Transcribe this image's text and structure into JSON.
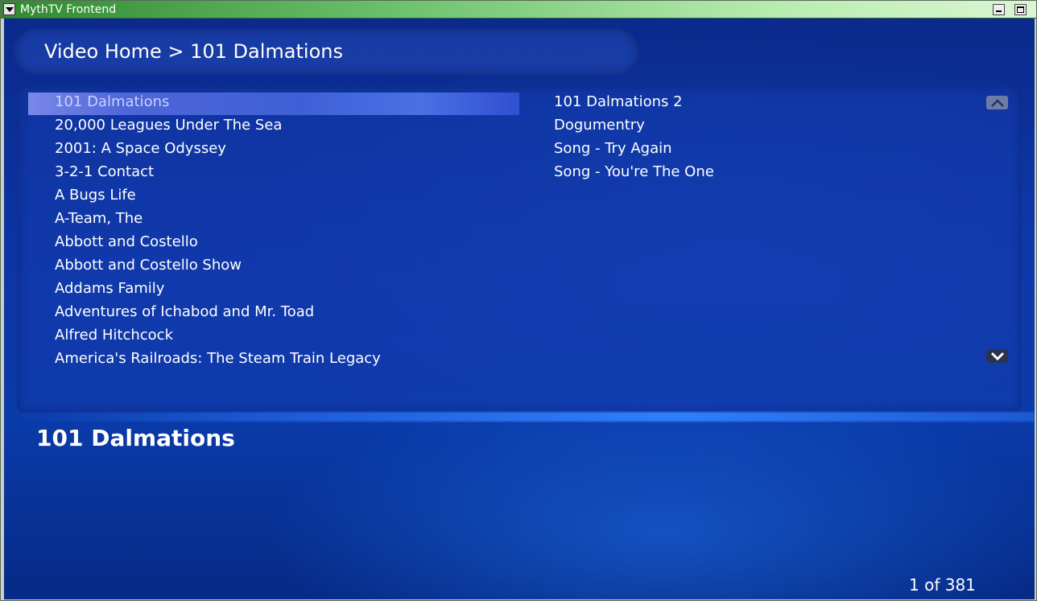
{
  "window": {
    "title": "MythTV Frontend"
  },
  "breadcrumb": {
    "text": "Video Home > 101 Dalmations"
  },
  "left_list": {
    "selected_index": 0,
    "items": [
      "101 Dalmations",
      "20,000 Leagues Under The Sea",
      "2001: A Space Odyssey",
      "3-2-1 Contact",
      "A Bugs Life",
      "A-Team, The",
      "Abbott and Costello",
      "Abbott and Costello Show",
      "Addams Family",
      "Adventures of Ichabod and Mr. Toad",
      "Alfred Hitchcock",
      "America's Railroads: The Steam Train Legacy"
    ]
  },
  "right_list": {
    "items": [
      "101 Dalmations 2",
      "Dogumentry",
      "Song - Try Again",
      "Song - You're The One"
    ]
  },
  "scroll": {
    "up_icon": "chevron-up-icon",
    "down_icon": "chevron-down-icon"
  },
  "detail": {
    "title": "101 Dalmations"
  },
  "status": {
    "position": "1 of 381"
  },
  "colors": {
    "background": "#0d35a6",
    "highlight": "#4e66d8",
    "text": "#ffffff",
    "titlebar": "#2f8a2f"
  }
}
